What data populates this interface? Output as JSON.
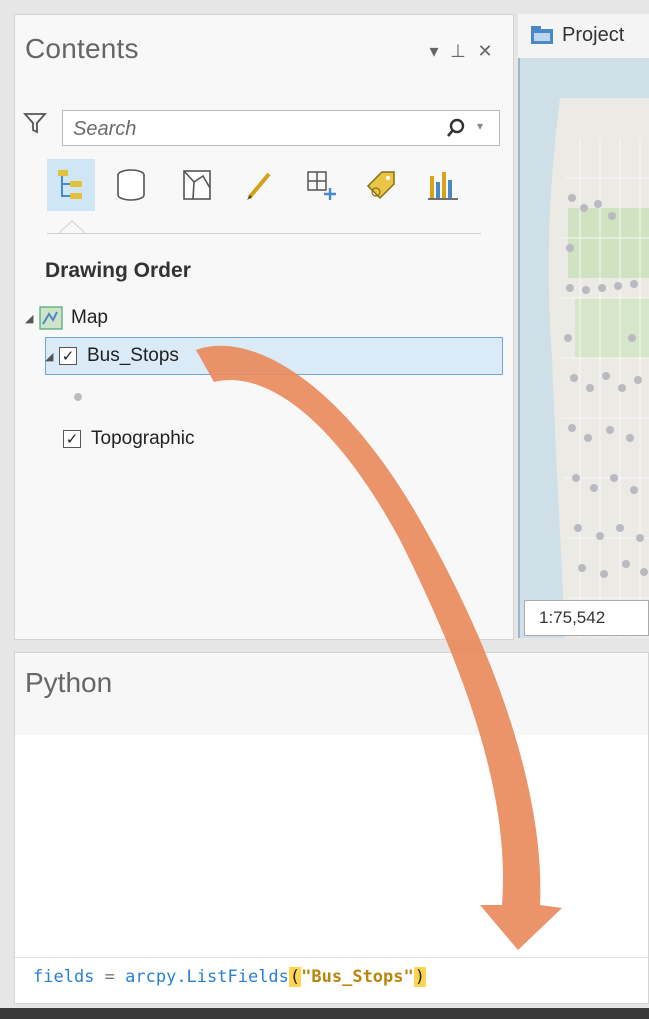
{
  "contents": {
    "title": "Contents",
    "controls": {
      "options": "▾",
      "pin": "⊥",
      "close": "✕"
    },
    "search": {
      "placeholder": "Search",
      "value": ""
    },
    "toolbar_icons": [
      "list-by-drawing-order-icon",
      "list-by-data-source-icon",
      "list-by-selection-icon",
      "list-by-editing-icon",
      "list-by-snapping-icon",
      "list-by-labeling-icon",
      "list-by-charts-icon"
    ],
    "section_heading": "Drawing Order",
    "tree": {
      "map": {
        "label": "Map",
        "expanded": true
      },
      "bus_stops": {
        "label": "Bus_Stops",
        "checked": true,
        "selected": true,
        "expanded": true
      },
      "topographic": {
        "label": "Topographic",
        "checked": true
      }
    }
  },
  "map_view": {
    "tab_label": "Project",
    "scale": "1:75,542"
  },
  "python": {
    "title": "Python",
    "code": {
      "var": "fields",
      "op": " = ",
      "fn": "arcpy.ListFields",
      "open": "(",
      "arg": "\"Bus_Stops\"",
      "close": ")"
    }
  },
  "colors": {
    "accent_selection": "#cfe6f7",
    "selection_border": "#6fa7d6",
    "arrow": "#e98a5c",
    "code_blue": "#2a7fd4",
    "code_string": "#b8860b"
  }
}
